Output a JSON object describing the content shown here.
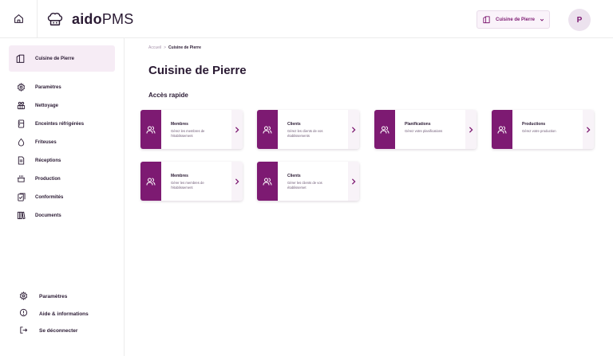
{
  "app": {
    "brand_bold": "aido",
    "brand_light": "PMS"
  },
  "topbar": {
    "site_selector_label": "Cuisine de Pierre",
    "avatar_initial": "P"
  },
  "sidebar": {
    "active_item": "Cuisine de Pierre",
    "items": [
      {
        "label": "Paramètres",
        "icon": "gear-icon"
      },
      {
        "label": "Nettoyage",
        "icon": "cleaning-icon"
      },
      {
        "label": "Enceintes réfrigérées",
        "icon": "fridge-icon"
      },
      {
        "label": "Friteuses",
        "icon": "droplet-icon"
      },
      {
        "label": "Réceptions",
        "icon": "receipt-icon"
      },
      {
        "label": "Production",
        "icon": "pot-icon"
      },
      {
        "label": "Conformités",
        "icon": "checklist-icon"
      },
      {
        "label": "Documents",
        "icon": "books-icon"
      }
    ],
    "bottom_items": [
      {
        "label": "Paramètres",
        "icon": "gear-icon"
      },
      {
        "label": "Aide & informations",
        "icon": "info-icon"
      },
      {
        "label": "Se déconnecter",
        "icon": "logout-icon"
      }
    ]
  },
  "main": {
    "breadcrumb": {
      "root": "Accueil",
      "separator": ">",
      "current": "Cuisine de Pierre"
    },
    "title": "Cuisine de Pierre",
    "section_title": "Accès rapide",
    "cards": [
      {
        "title": "Membres",
        "desc": "Gérez les membres de l'établissement",
        "icon": "users-icon"
      },
      {
        "title": "Clients",
        "desc": "Gérez les clients de vos établissements",
        "icon": "users-icon"
      },
      {
        "title": "Planifications",
        "desc": "Gérez votre planifications",
        "icon": "users-icon"
      },
      {
        "title": "Productions",
        "desc": "Gérez votre production",
        "icon": "users-icon"
      },
      {
        "title": "Membres",
        "desc": "Gérer les membres de l'établissement",
        "icon": "users-icon"
      },
      {
        "title": "Clients",
        "desc": "Gérer les clients de vos établissemet",
        "icon": "users-icon"
      }
    ]
  },
  "colors": {
    "accent": "#7d1a72",
    "accent_light": "#f6ecf5",
    "text": "#2a1a33"
  }
}
